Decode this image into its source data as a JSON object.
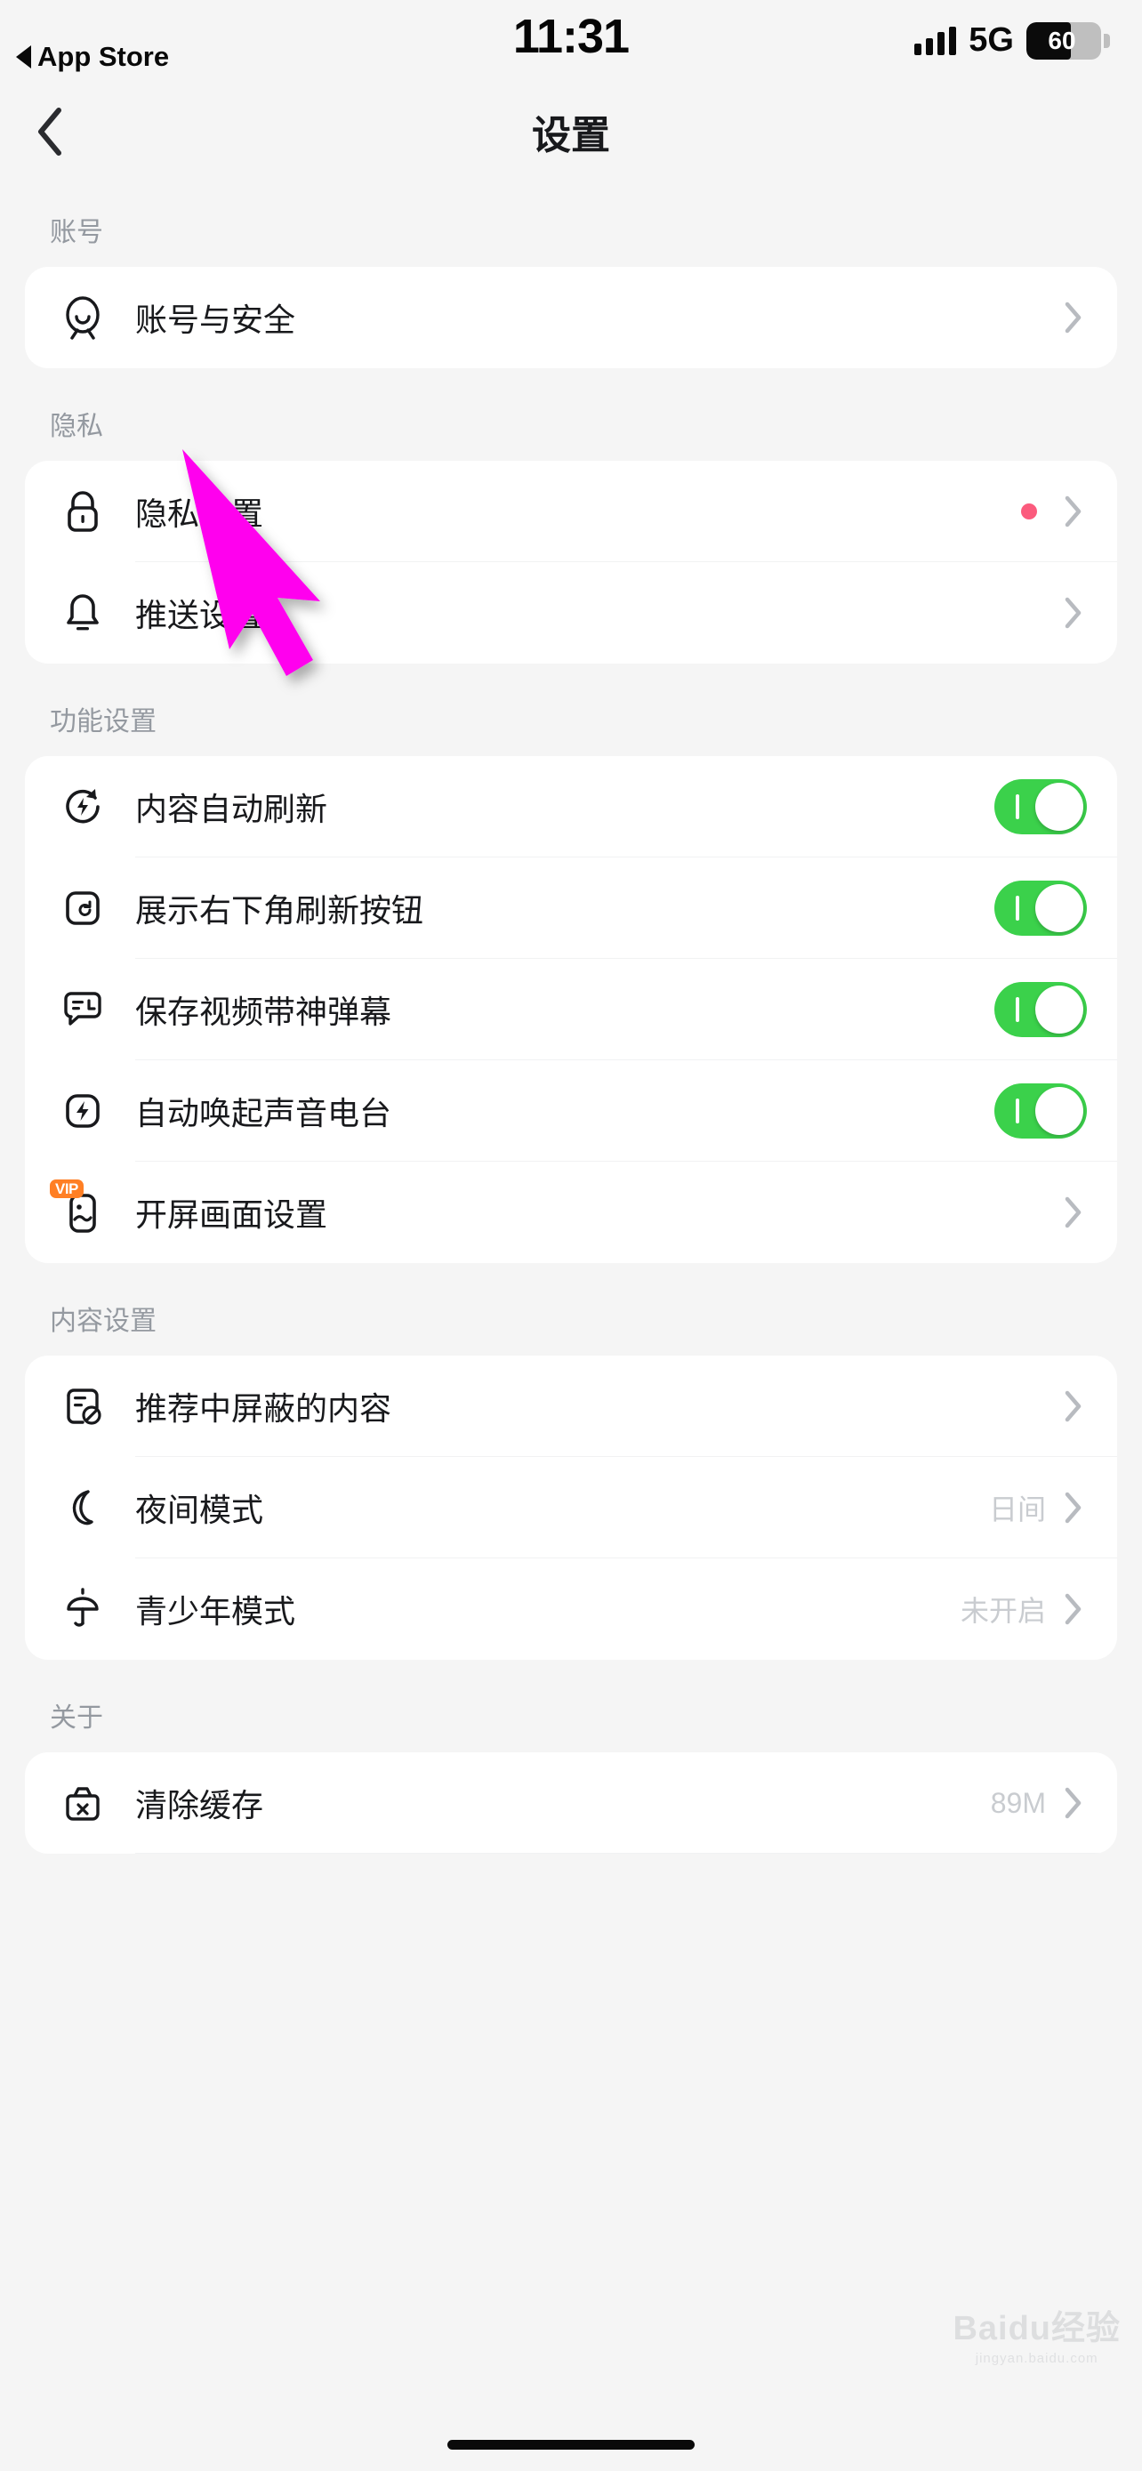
{
  "status_bar": {
    "time": "11:31",
    "back_app_label": "App Store",
    "network": "5G",
    "battery_level": "60",
    "battery_percent": 60,
    "signal_bars": 4
  },
  "nav": {
    "title": "设置",
    "back_icon": "chevron-left-icon"
  },
  "sections": [
    {
      "header": "账号",
      "rows": [
        {
          "icon": "account-avatar-icon",
          "label": "账号与安全",
          "type": "link"
        }
      ]
    },
    {
      "header": "隐私",
      "rows": [
        {
          "icon": "lock-icon",
          "label": "隐私设置",
          "type": "link",
          "badge_dot": true
        },
        {
          "icon": "bell-icon",
          "label": "推送设置",
          "type": "link"
        }
      ]
    },
    {
      "header": "功能设置",
      "rows": [
        {
          "icon": "auto-refresh-icon",
          "label": "内容自动刷新",
          "type": "toggle",
          "on": true
        },
        {
          "icon": "refresh-button-corner-icon",
          "label": "展示右下角刷新按钮",
          "type": "toggle",
          "on": true
        },
        {
          "icon": "save-video-danmaku-icon",
          "label": "保存视频带神弹幕",
          "type": "toggle",
          "on": true
        },
        {
          "icon": "audio-radio-icon",
          "label": "自动唤起声音电台",
          "type": "toggle",
          "on": true
        },
        {
          "icon": "splash-screen-icon",
          "label": "开屏画面设置",
          "type": "link",
          "vip_badge": "VIP"
        }
      ]
    },
    {
      "header": "内容设置",
      "rows": [
        {
          "icon": "blocked-content-icon",
          "label": "推荐中屏蔽的内容",
          "type": "link"
        },
        {
          "icon": "moon-icon",
          "label": "夜间模式",
          "type": "link",
          "value": "日间"
        },
        {
          "icon": "teen-mode-icon",
          "label": "青少年模式",
          "type": "link",
          "value": "未开启"
        }
      ]
    },
    {
      "header": "关于",
      "rows": [
        {
          "icon": "clear-cache-icon",
          "label": "清除缓存",
          "type": "link",
          "value": "89M"
        }
      ]
    }
  ],
  "colors": {
    "toggle_on": "#3BD14B",
    "badge_dot": "#FB5B7D",
    "vip_badge": "#FF7F24",
    "cursor_arrow": "#FF00EE",
    "page_background": "#F5F5F5",
    "card_background": "#FFFFFF",
    "primary_text": "#18191C",
    "secondary_text": "#9499A0"
  },
  "annotation": {
    "cursor_icon": "mouse-pointer-arrow",
    "points_at": "推送设置"
  },
  "watermark": {
    "main": "Baidu经验",
    "sub": "jingyan.baidu.com"
  }
}
